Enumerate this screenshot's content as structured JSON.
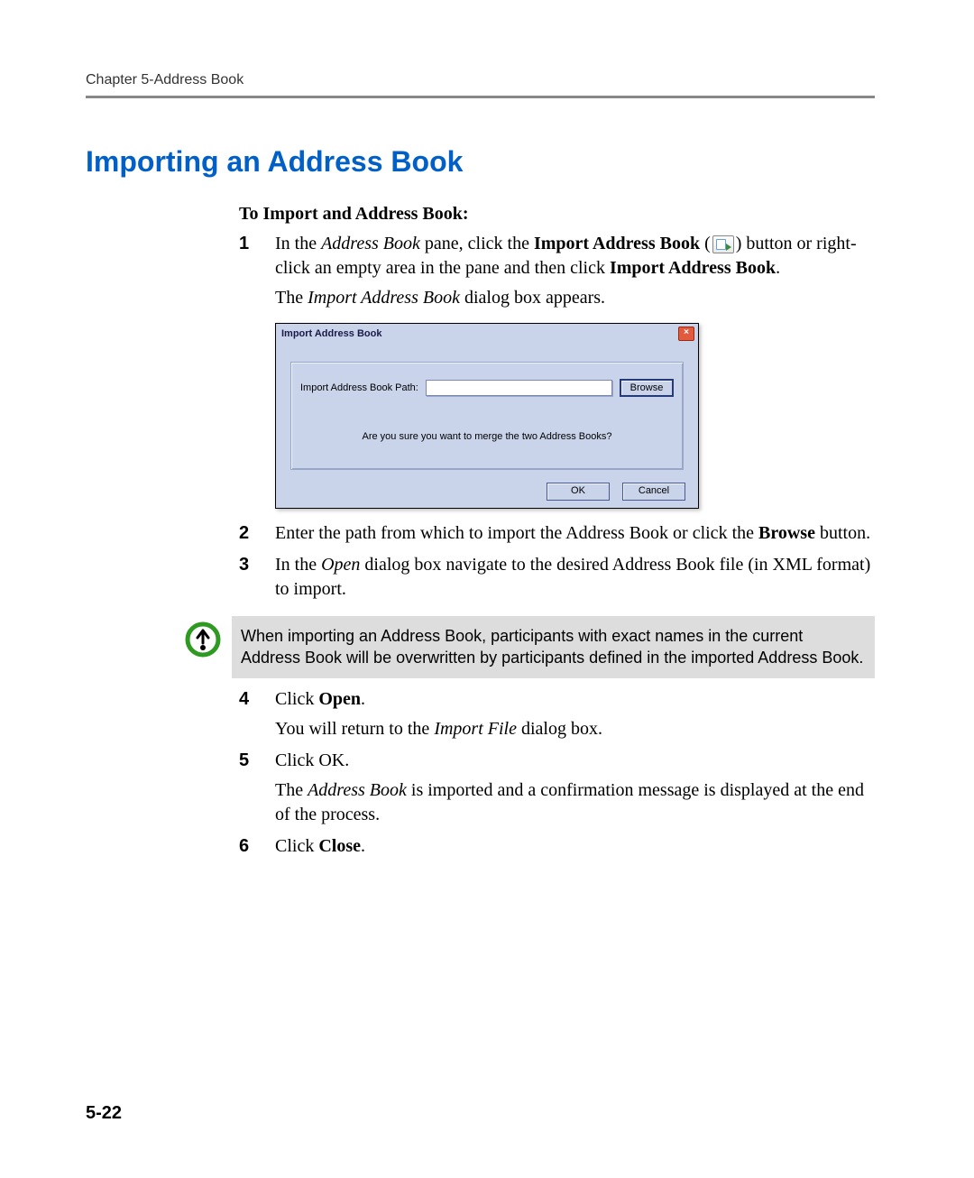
{
  "header": {
    "running": "Chapter 5-Address Book",
    "page_number": "5-22"
  },
  "title": "Importing an Address Book",
  "subhead": "To Import and Address Book:",
  "steps": {
    "s1": {
      "num": "1",
      "pre": "In the ",
      "em1": "Address Book",
      "mid1": " pane, click the ",
      "b1": "Import Address Book",
      "mid2": " (",
      "icon_name": "import-address-book-icon",
      "mid3": ") button or right-click an empty area in the pane and then click ",
      "b2": "Import Address Book",
      "post": ".",
      "follow_pre": "The ",
      "follow_em": "Import Address Book",
      "follow_post": " dialog box appears."
    },
    "s2": {
      "num": "2",
      "pre": "Enter the path from which to import the Address Book or click the ",
      "b1": "Browse",
      "post": " button."
    },
    "s3": {
      "num": "3",
      "pre": "In the ",
      "em1": "Open",
      "post": " dialog box navigate to the desired Address Book file (in XML format) to import."
    },
    "s4": {
      "num": "4",
      "pre": "Click ",
      "b1": "Open",
      "post": ".",
      "follow_pre": "You will return to the ",
      "follow_em": "Import File",
      "follow_post": " dialog box."
    },
    "s5": {
      "num": "5",
      "text": "Click OK.",
      "follow_pre": "The ",
      "follow_em": "Address Book",
      "follow_post": " is imported and a confirmation message is displayed at the end of the process."
    },
    "s6": {
      "num": "6",
      "pre": "Click ",
      "b1": "Close",
      "post": "."
    }
  },
  "dialog": {
    "title": "Import Address Book",
    "path_label": "Import Address Book Path:",
    "path_value": "",
    "browse": "Browse",
    "confirm": "Are you sure you want to merge the two Address Books?",
    "ok": "OK",
    "cancel": "Cancel"
  },
  "note": {
    "text": "When importing an Address Book, participants with exact names in the current Address Book will be overwritten by participants defined in the imported Address Book."
  }
}
